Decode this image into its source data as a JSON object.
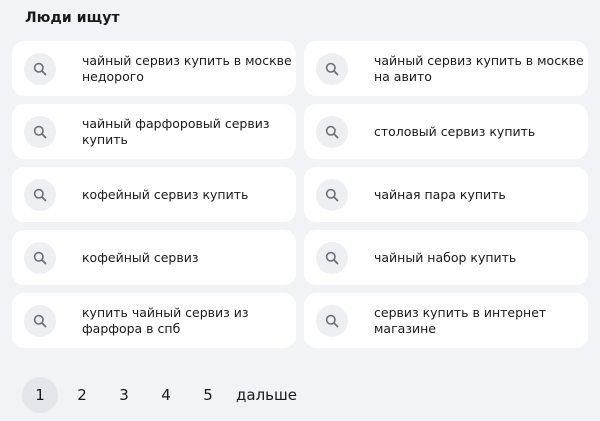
{
  "section_title": "Люди ищут",
  "suggestions": [
    {
      "icon": "search-icon",
      "text": "чайный сервиз купить в москве недорого"
    },
    {
      "icon": "search-icon",
      "text": "чайный сервиз купить в москве на авито"
    },
    {
      "icon": "search-icon",
      "text": "чайный фарфоровый сервиз купить"
    },
    {
      "icon": "search-icon",
      "text": "столовый сервиз купить"
    },
    {
      "icon": "search-icon",
      "text": "кофейный сервиз купить"
    },
    {
      "icon": "search-icon",
      "text": "чайная пара купить"
    },
    {
      "icon": "search-icon",
      "text": "кофейный сервиз"
    },
    {
      "icon": "search-icon",
      "text": "чайный набор купить"
    },
    {
      "icon": "search-icon",
      "text": "купить чайный сервиз из фарфора в спб"
    },
    {
      "icon": "search-icon",
      "text": "сервиз купить в интернет магазине"
    }
  ],
  "pagination": {
    "pages": [
      "1",
      "2",
      "3",
      "4",
      "5"
    ],
    "active": "1",
    "next_label": "дальше"
  },
  "colors": {
    "background": "#f2f3f6",
    "card": "#ffffff",
    "icon_bg": "#eeeff3",
    "icon": "#6b6f78",
    "active_page_bg": "#e4e6ec"
  }
}
